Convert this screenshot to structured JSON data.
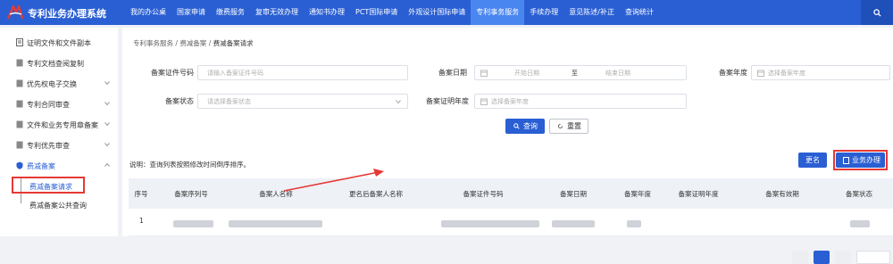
{
  "header": {
    "app_title": "专利业务办理系统",
    "nav": [
      "我的办公桌",
      "国家申请",
      "缴费服务",
      "复审无效办理",
      "通知书办理",
      "PCT国际申请",
      "外观设计国际申请",
      "专利事务服务",
      "手续办理",
      "意见陈述/补正",
      "查询统计"
    ],
    "active_nav": "专利事务服务",
    "search_icon": "search-icon"
  },
  "sidebar": {
    "items": [
      "证明文件和文件副本",
      "专利文档查阅复制",
      "优先权电子交换",
      "专利合同审查",
      "文件和业务专用章备案",
      "专利优先审查",
      "费减备案"
    ],
    "sub_items": [
      "费减备案请求",
      "费减备案公共查询"
    ],
    "active_sub": "费减备案请求"
  },
  "breadcrumb": {
    "parts": [
      "专利事务服务",
      "费减备案",
      "费减备案请求"
    ],
    "sep": "/"
  },
  "form": {
    "cert_no_label": "备案证件号码",
    "cert_no_placeholder": "请输入备案证件号码",
    "date_label": "备案日期",
    "start_placeholder": "开始日期",
    "to": "至",
    "end_placeholder": "结束日期",
    "year_label": "备案年度",
    "year_placeholder": "选择备案年度",
    "status_label": "备案状态",
    "status_placeholder": "请选择备案状态",
    "proof_year_label": "备案证明年度",
    "proof_year_placeholder": "选择备案年度",
    "query_button": "查询",
    "reset_button": "重置"
  },
  "table": {
    "note": "说明：查询列表按照修改时间倒序排序。",
    "rename_button": "更名",
    "handle_button": "业务办理",
    "columns": [
      "序号",
      "备案序列号",
      "备案人名称",
      "更名后备案人名称",
      "备案证件号码",
      "备案日期",
      "备案年度",
      "备案证明年度",
      "备案有效期",
      "备案状态"
    ],
    "rows": [
      {
        "index": "1"
      }
    ]
  },
  "colors": {
    "header_blue": "#2a5fd3",
    "active_nav": "#4a86f0",
    "annotation_red": "#e53935"
  }
}
